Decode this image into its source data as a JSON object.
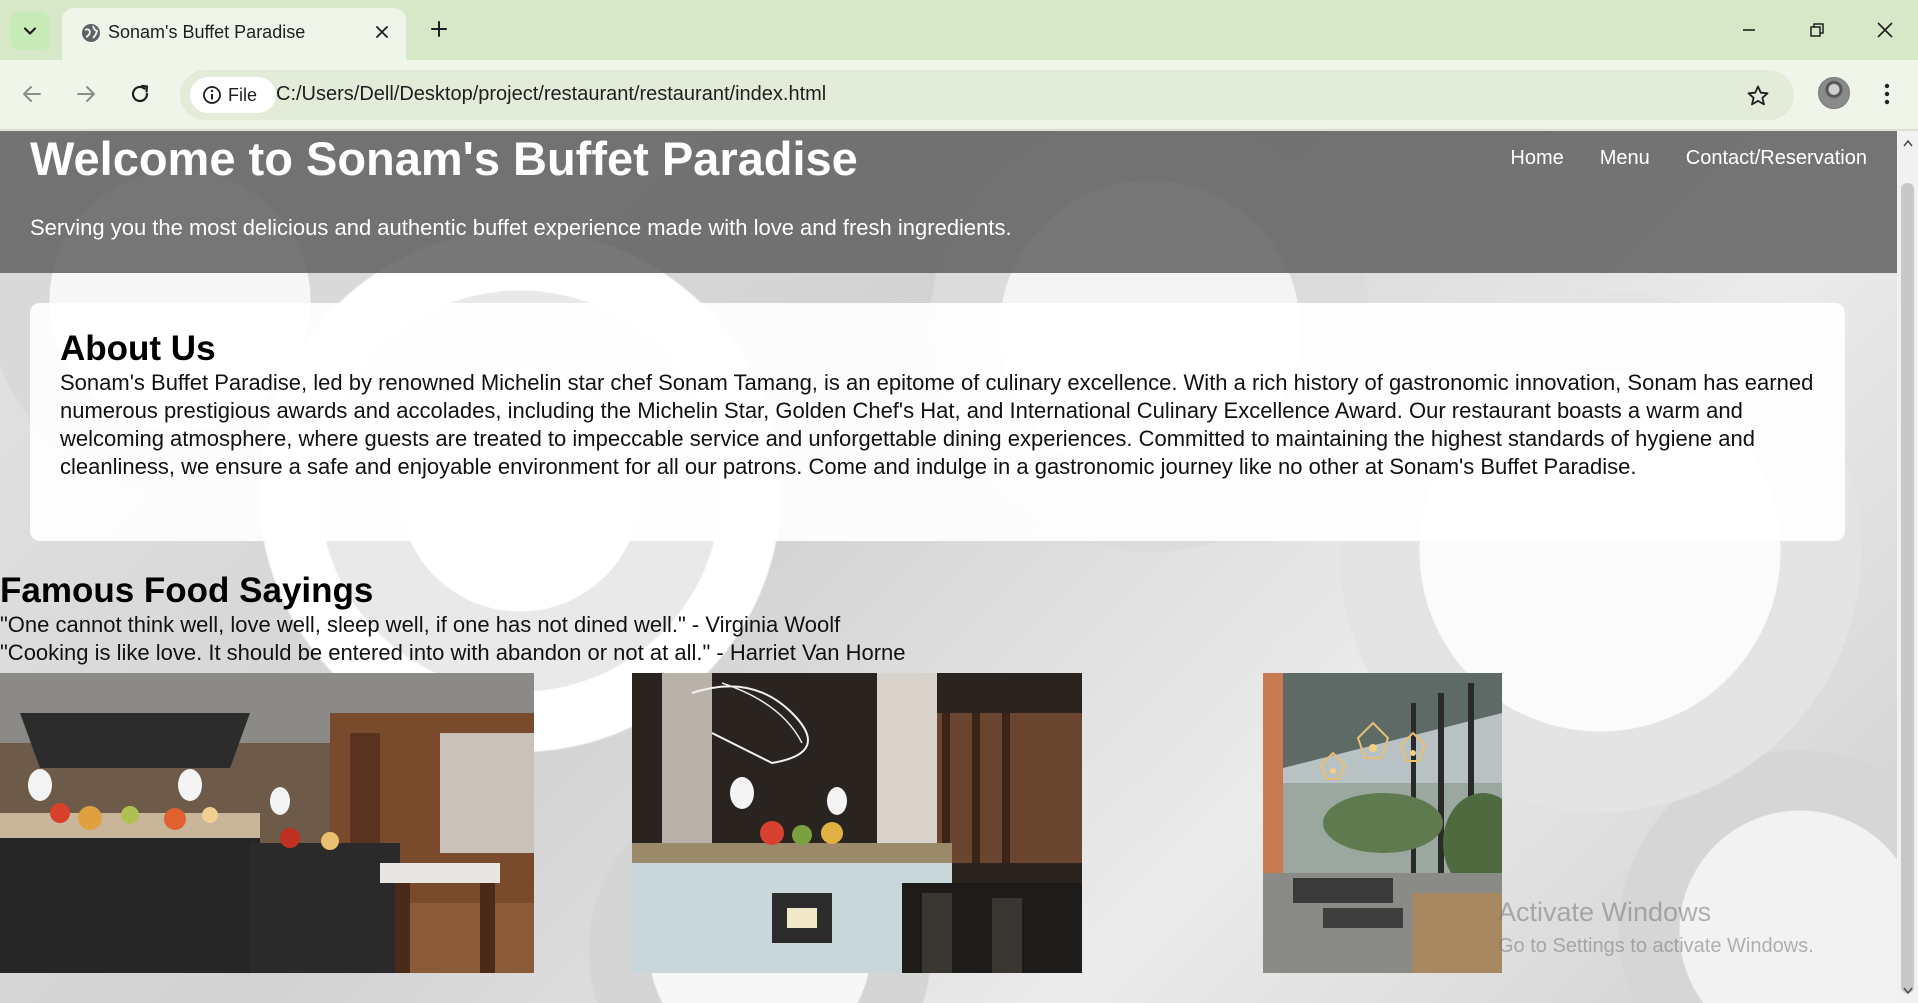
{
  "browser": {
    "tab_title": "Sonam's Buffet Paradise",
    "url_scheme_label": "File",
    "url": "C:/Users/Dell/Desktop/project/restaurant/restaurant/index.html"
  },
  "site": {
    "title": "Welcome to Sonam's Buffet Paradise",
    "tagline": "Serving you the most delicious and authentic buffet experience made with love and fresh ingredients.",
    "nav": [
      "Home",
      "Menu",
      "Contact/Reservation"
    ]
  },
  "about": {
    "heading": "About Us",
    "body": "Sonam's Buffet Paradise, led by renowned Michelin star chef Sonam Tamang, is an epitome of culinary excellence. With a rich history of gastronomic innovation, Sonam has earned numerous prestigious awards and accolades, including the Michelin Star, Golden Chef's Hat, and International Culinary Excellence Award. Our restaurant boasts a warm and welcoming atmosphere, where guests are treated to impeccable service and unforgettable dining experiences. Committed to maintaining the highest standards of hygiene and cleanliness, we ensure a safe and enjoyable environment for all our patrons. Come and indulge in a gastronomic journey like no other at Sonam's Buffet Paradise."
  },
  "sayings": {
    "heading": "Famous Food Sayings",
    "quotes": [
      "\"One cannot think well, love well, sleep well, if one has not dined well.\" - Virginia Woolf",
      "\"Cooking is like love. It should be entered into with abandon or not at all.\" - Harriet Van Horne"
    ]
  },
  "watermark": {
    "line1": "Activate Windows",
    "line2": "Go to Settings to activate Windows."
  },
  "icons": {
    "tab_menu": "chevron-down-icon",
    "favicon": "globe-icon",
    "tab_close": "close-icon",
    "new_tab": "plus-icon",
    "back": "arrow-left-icon",
    "forward": "arrow-right-icon",
    "reload": "reload-icon",
    "site_info": "info-icon",
    "bookmark": "star-icon",
    "menu": "kebab-menu-icon"
  },
  "colors": {
    "tabbar_bg": "#d7e8c8",
    "toolbar_bg": "#f0f5ea",
    "header_overlay": "#5f5f5f",
    "card_bg": "#ffffff"
  }
}
